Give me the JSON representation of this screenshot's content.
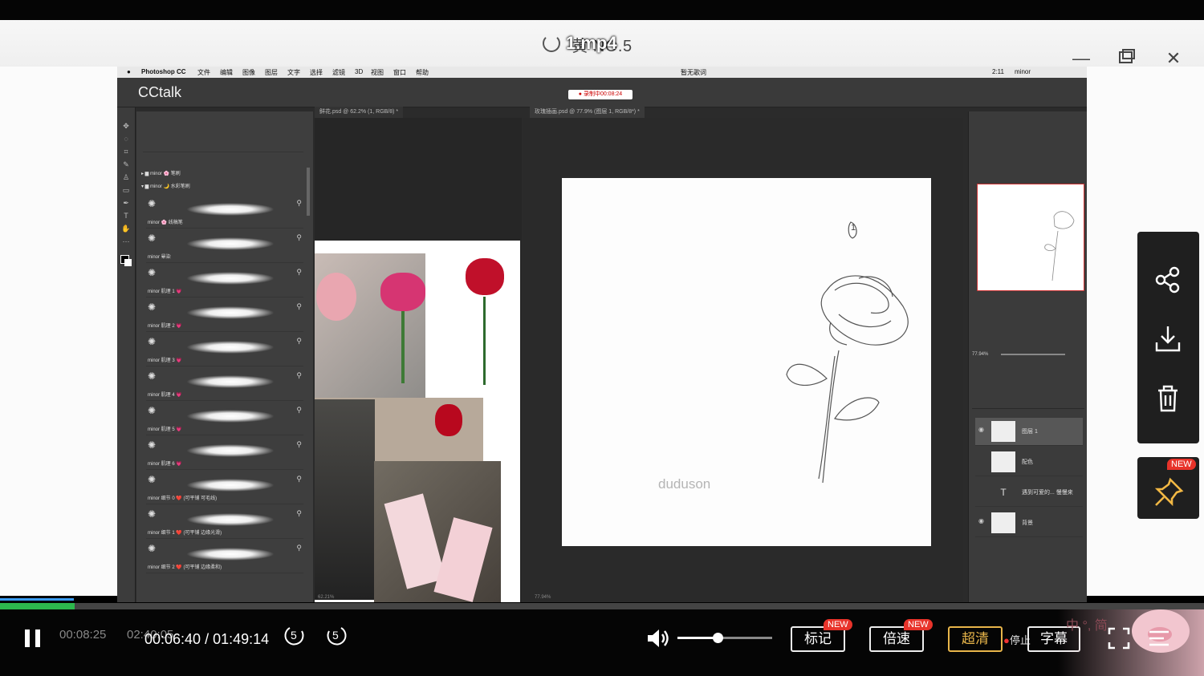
{
  "window": {
    "title": "1.mp4",
    "title_overlay": "黄      NO.5",
    "controls": [
      "minimize",
      "restore",
      "close"
    ]
  },
  "ps": {
    "menubar": {
      "app": "Photoshop CC",
      "items": [
        "文件",
        "编辑",
        "图像",
        "图层",
        "文字",
        "选择",
        "滤镜",
        "3D",
        "视图",
        "窗口",
        "帮助"
      ],
      "center": "暂无歌词",
      "clock": "2:11",
      "user": "minor"
    },
    "logo": "CCtalk",
    "rec_badge": "● 录制中00:08:24",
    "doc_tab_left": "鲜花.psd @ 62.2% (1, RGB/8) *",
    "doc_tab_right": "玫瑰插画.psd @ 77.9% (图层 1, RGB/8*) *",
    "brush_groups": [
      "minor 🌸 笔刷",
      "minor 🌙 水彩笔刷"
    ],
    "brushes": [
      {
        "name": "minor 🌸 线稿笔"
      },
      {
        "name": "minor 晕染"
      },
      {
        "name": "minor 肌理 1 💗"
      },
      {
        "name": "minor 肌理 2 💗"
      },
      {
        "name": "minor 肌理 3 💗"
      },
      {
        "name": "minor 肌理 4 💗"
      },
      {
        "name": "minor 肌理 5 💗"
      },
      {
        "name": "minor 肌理 6 💗"
      },
      {
        "name": "minor 细节 0 ❤️ (可平铺 可毛线)"
      },
      {
        "name": "minor 细节 1 ❤️ (可平铺 边缘光滑)"
      },
      {
        "name": "minor 细节 2 ❤️ (可平铺 边缘柔和)"
      }
    ],
    "watermark": "duduson",
    "canvas_number": "1",
    "nav_zoom": "77.94%",
    "layers": [
      {
        "name": "图层 1",
        "selected": true,
        "visible": true
      },
      {
        "name": "配色",
        "selected": false,
        "visible": false
      },
      {
        "name": "遇到可爱的... 慢慢来",
        "selected": false,
        "visible": false,
        "type": "text"
      },
      {
        "name": "背景",
        "selected": false,
        "visible": true
      }
    ],
    "status_left": "62.21%",
    "status_mid": "77.94%"
  },
  "side_panel": {
    "icons": [
      "share-icon",
      "download-icon",
      "trash-icon"
    ],
    "pin_tag": "NEW"
  },
  "player": {
    "progress_fraction": 0.061,
    "buffer_fraction": 0.062,
    "current_time": "00:06:40",
    "total_time": "01:49:14",
    "time_separator": "/",
    "ghost_time_1": "00:08:25",
    "ghost_time_2": "02:40:05",
    "rewind_label": "5",
    "forward_label": "5",
    "volume_fraction": 0.42,
    "buttons": {
      "mark": "标记",
      "speed": "倍速",
      "quality": "超清",
      "subtitle": "字幕",
      "new_tag": "NEW",
      "stop_fragment": "停止"
    },
    "ime_text": "中 °, 简"
  }
}
